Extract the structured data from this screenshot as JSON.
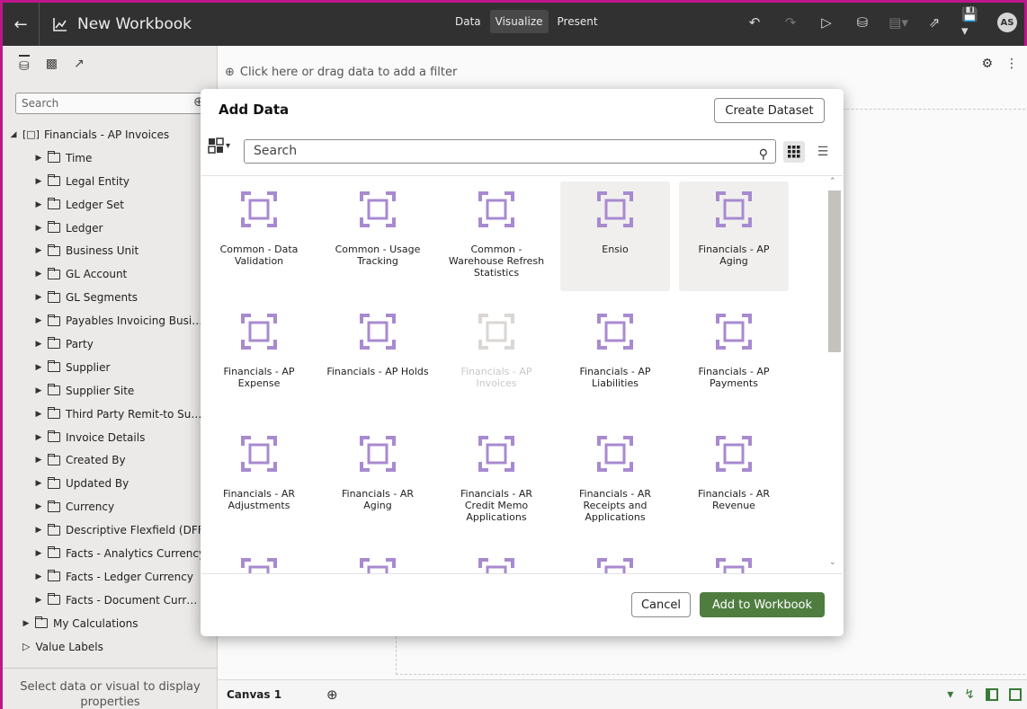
{
  "header": {
    "title": "New Workbook",
    "modes": [
      "Data",
      "Visualize",
      "Present"
    ],
    "active_mode": "Visualize",
    "avatar": "AS"
  },
  "left_pane": {
    "search_placeholder": "Search",
    "root": "Financials - AP Invoices",
    "folders": [
      "Time",
      "Legal Entity",
      "Ledger Set",
      "Ledger",
      "Business Unit",
      "GL Account",
      "GL Segments",
      "Payables Invoicing Busi…",
      "Party",
      "Supplier",
      "Supplier Site",
      "Third Party Remit-to Su…",
      "Invoice Details",
      "Created By",
      "Updated By",
      "Currency",
      "Descriptive Flexfield (DFF",
      "Facts - Analytics Currency",
      "Facts - Ledger Currency",
      "Facts - Document Curr…"
    ],
    "my_calculations": "My Calculations",
    "value_labels": "Value Labels",
    "footer": "Select data or visual to display properties"
  },
  "canvas": {
    "filter_hint": "Click here or drag data to add a filter",
    "tab_name": "Canvas 1"
  },
  "dialog": {
    "title": "Add Data",
    "create_dataset": "Create Dataset",
    "search_placeholder": "Search",
    "tiles": [
      {
        "label": "Common - Data Validation",
        "state": "normal"
      },
      {
        "label": "Common - Usage Tracking",
        "state": "normal"
      },
      {
        "label": "Common - Warehouse Refresh Statistics",
        "state": "normal"
      },
      {
        "label": "Ensio",
        "state": "highlight"
      },
      {
        "label": "Financials - AP Aging",
        "state": "highlight"
      },
      {
        "label": "Financials - AP Expense",
        "state": "normal"
      },
      {
        "label": "Financials - AP Holds",
        "state": "normal"
      },
      {
        "label": "Financials - AP Invoices",
        "state": "faded"
      },
      {
        "label": "Financials - AP Liabilities",
        "state": "normal"
      },
      {
        "label": "Financials - AP Payments",
        "state": "normal"
      },
      {
        "label": "Financials - AR Adjustments",
        "state": "normal"
      },
      {
        "label": "Financials - AR Aging",
        "state": "normal"
      },
      {
        "label": "Financials - AR Credit Memo Applications",
        "state": "normal"
      },
      {
        "label": "Financials - AR Receipts and Applications",
        "state": "normal"
      },
      {
        "label": "Financials - AR Revenue",
        "state": "normal"
      },
      {
        "label": "",
        "state": "normal"
      },
      {
        "label": "",
        "state": "normal"
      },
      {
        "label": "",
        "state": "normal"
      },
      {
        "label": "",
        "state": "normal"
      },
      {
        "label": "",
        "state": "normal"
      }
    ],
    "cancel": "Cancel",
    "add": "Add to Workbook"
  },
  "colors": {
    "accent_border": "#c2188e",
    "primary_button": "#4f7d40",
    "dataset_icon": "#a88ad0"
  }
}
